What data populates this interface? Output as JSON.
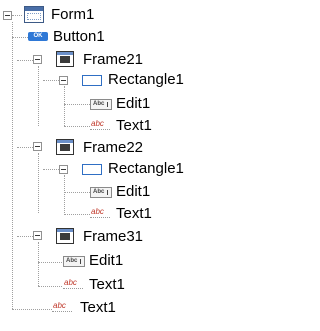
{
  "tree": {
    "root": {
      "label": "Form1",
      "icon": "form-icon"
    },
    "button1": {
      "label": "Button1",
      "icon": "button-icon",
      "icon_text": "OK"
    },
    "frame21": {
      "label": "Frame21",
      "icon": "frame-icon"
    },
    "frame21_rect": {
      "label": "Rectangle1",
      "icon": "rectangle-icon"
    },
    "frame21_edit": {
      "label": "Edit1",
      "icon": "edit-icon",
      "icon_text": "Abc"
    },
    "frame21_text": {
      "label": "Text1",
      "icon": "text-icon",
      "icon_text": "abc"
    },
    "frame22": {
      "label": "Frame22",
      "icon": "frame-icon"
    },
    "frame22_rect": {
      "label": "Rectangle1",
      "icon": "rectangle-icon"
    },
    "frame22_edit": {
      "label": "Edit1",
      "icon": "edit-icon",
      "icon_text": "Abc"
    },
    "frame22_text": {
      "label": "Text1",
      "icon": "text-icon",
      "icon_text": "abc"
    },
    "frame31": {
      "label": "Frame31",
      "icon": "frame-icon"
    },
    "frame31_edit": {
      "label": "Edit1",
      "icon": "edit-icon",
      "icon_text": "Abc"
    },
    "frame31_text": {
      "label": "Text1",
      "icon": "text-icon",
      "icon_text": "abc"
    },
    "text1": {
      "label": "Text1",
      "icon": "text-icon",
      "icon_text": "abc"
    }
  },
  "colors": {
    "connector": "#a0a0a0",
    "button_icon": "#2e78d6",
    "rectangle_icon": "#2f6fc4",
    "text_icon": "#c0392b"
  }
}
